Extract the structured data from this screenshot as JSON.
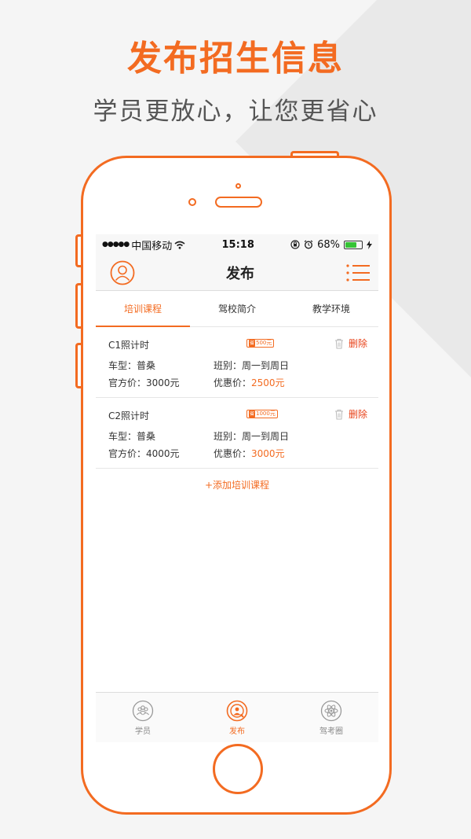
{
  "promo": {
    "headline": "发布招生信息",
    "subline": "学员更放心，让您更省心"
  },
  "status_bar": {
    "signal": "●●●●●",
    "carrier": "中国移动",
    "time": "15:18",
    "battery_percent": "68%",
    "battery_level": 0.68
  },
  "nav": {
    "title": "发布",
    "avatar_icon": "user-circle-icon",
    "menu_icon": "list-menu-icon"
  },
  "tabs": [
    {
      "label": "培训课程",
      "active": true
    },
    {
      "label": "驾校简介",
      "active": false
    },
    {
      "label": "教学环境",
      "active": false
    }
  ],
  "courses": [
    {
      "name": "C1照计时",
      "tag_prefix": "省",
      "tag_amount": "500元",
      "delete_label": "删除",
      "car_type": "车型：普桑",
      "class_type": "班别：周一到周日",
      "official_label": "官方价：",
      "official_price": "3000元",
      "discount_label": "优惠价：",
      "discount_price": "2500元"
    },
    {
      "name": "C2照计时",
      "tag_prefix": "省",
      "tag_amount": "1000元",
      "delete_label": "删除",
      "car_type": "车型：普桑",
      "class_type": "班别：周一到周日",
      "official_label": "官方价：",
      "official_price": "4000元",
      "discount_label": "优惠价：",
      "discount_price": "3000元"
    }
  ],
  "add_course_label": "+添加培训课程",
  "tabbar": [
    {
      "label": "学员",
      "icon": "students-icon",
      "active": false
    },
    {
      "label": "发布",
      "icon": "publish-icon",
      "active": true
    },
    {
      "label": "驾考圈",
      "icon": "atom-icon",
      "active": false
    }
  ],
  "colors": {
    "accent": "#f36b21",
    "delete": "#e8431a"
  }
}
